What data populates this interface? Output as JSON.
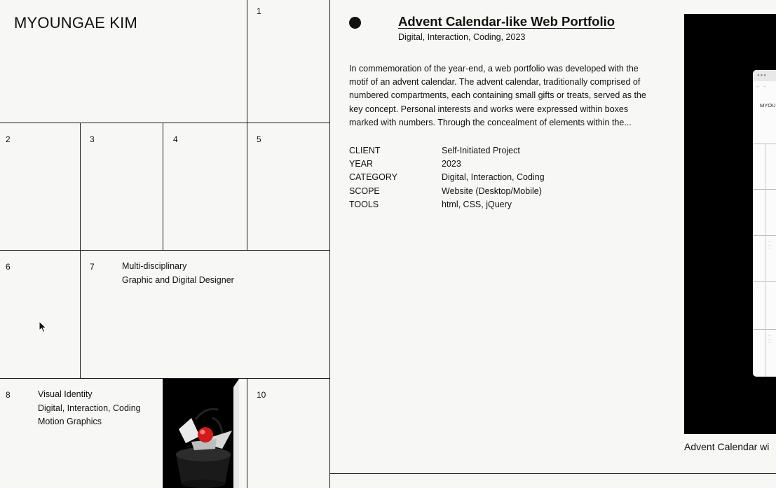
{
  "site": {
    "name": "MYOUNGAE KIM"
  },
  "grid": {
    "cells": [
      {
        "number": "1"
      },
      {
        "number": "2"
      },
      {
        "number": "3"
      },
      {
        "number": "4"
      },
      {
        "number": "5"
      },
      {
        "number": "6"
      },
      {
        "number": "7",
        "lines": [
          "Multi-disciplinary",
          "Graphic and Digital Designer"
        ]
      },
      {
        "number": "8",
        "lines": [
          "Visual Identity",
          "Digital, Interaction, Coding",
          "Motion Graphics"
        ]
      },
      {
        "number": "10"
      }
    ]
  },
  "project": {
    "title": "Advent Calendar-like Web Portfolio",
    "subtitle": "Digital, Interaction, Coding, 2023",
    "description": "In commemoration of the year-end, a web portfolio was developed with the motif of an advent calendar. The advent calendar, traditionally comprised of numbered compartments, each containing small gifts or treats, served as the key concept. Personal interests and works were expressed within boxes marked with numbers. Through the concealment of elements within the...",
    "details": [
      {
        "key": "CLIENT",
        "value": "Self-Initiated Project"
      },
      {
        "key": "YEAR",
        "value": "2023"
      },
      {
        "key": "CATEGORY",
        "value": "Digital, Interaction, Coding"
      },
      {
        "key": "SCOPE",
        "value": "Website (Desktop/Mobile)"
      },
      {
        "key": "TOOLS",
        "value": "html, CSS, jQuery"
      }
    ],
    "preview": {
      "mini_name": "MYOU",
      "caption": "Advent Calendar wi"
    }
  }
}
